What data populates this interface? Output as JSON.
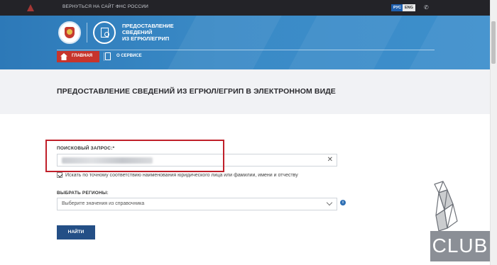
{
  "topbar": {
    "back_link": "ВЕРНУТЬСЯ НА САЙТ ФНС РОССИИ",
    "lang_ru": "РУС",
    "lang_en": "ENG",
    "phone_icon": "phone-icon"
  },
  "header": {
    "service_title_line1": "ПРЕДОСТАВЛЕНИЕ",
    "service_title_line2": "СВЕДЕНИЙ",
    "service_title_line3": "ИЗ ЕГРЮЛ/ЕГРИП",
    "nav_home": "ГЛАВНАЯ",
    "nav_about": "О СЕРВИСЕ",
    "colors": {
      "band": "#3a8ac6",
      "home_active": "#c7342c"
    }
  },
  "page": {
    "title": "ПРЕДОСТАВЛЕНИЕ СВЕДЕНИЙ ИЗ ЕГРЮЛ/ЕГРИП В ЭЛЕКТРОННОМ ВИДЕ"
  },
  "form": {
    "query_label": "ПОИСКОВЫЙ ЗАПРОС:*",
    "query_value_blurred": true,
    "clear_symbol": "✕",
    "exact_match_checked": true,
    "exact_match_label": "Искать по точному соответствию наименования юридического лица или фамилии, имени и отчеству",
    "region_label": "ВЫБРАТЬ РЕГИОНЫ:",
    "region_placeholder": "Выберите значения из справочника",
    "info_symbol": "i",
    "submit_label": "НАЙТИ",
    "colors": {
      "submit": "#244f86",
      "highlight": "#c0202a"
    }
  },
  "watermark": {
    "text": "CLUB"
  }
}
